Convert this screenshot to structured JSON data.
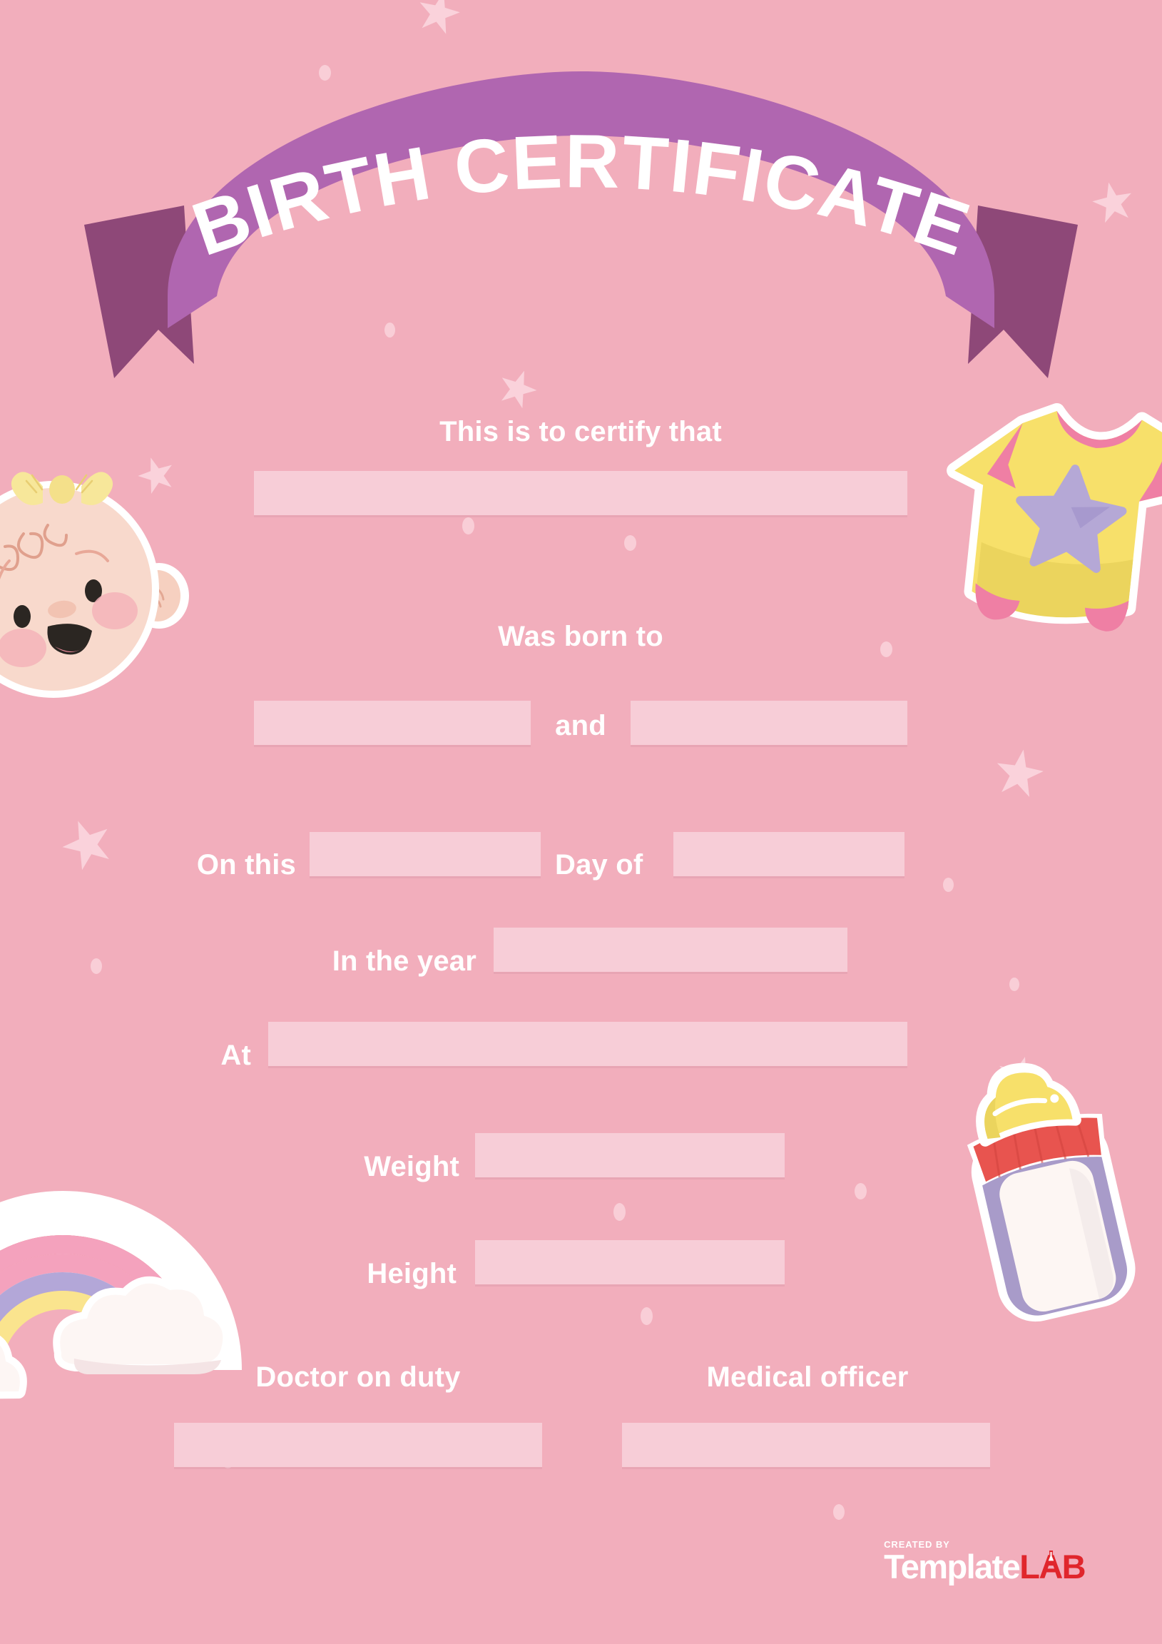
{
  "document": {
    "type": "birth-certificate-template",
    "title": "BIRTH CERTIFICATE"
  },
  "colors": {
    "background": "#F2AEBC",
    "field_fill": "#F7CDD7",
    "banner_front": "#B066B0",
    "banner_fold": "#8E4878",
    "text": "#FFFFFF",
    "star_decor": "#FAD4DC",
    "logo_red": "#E0262C",
    "onesie_yellow": "#F7E06A",
    "onesie_trim": "#EF7FA4",
    "onesie_star": "#B5A8D6",
    "bottle_cap": "#F7E06A",
    "bottle_ring": "#E8544F",
    "bottle_body": "#A89BC9",
    "bottle_milk": "#FDF6F3",
    "baby_skin": "#F8D9CC",
    "baby_bow": "#F7E79A",
    "baby_cheek": "#F4B3B9",
    "rainbow_band_1": "#E35F5A",
    "rainbow_band_2": "#F4A2BD",
    "rainbow_band_3": "#B3A7D8",
    "rainbow_band_4": "#FAE48E",
    "cloud": "#FDF6F4"
  },
  "banner": {
    "title": "BIRTH CERTIFICATE"
  },
  "form": {
    "certify_line": {
      "label": "This is to certify that",
      "field_value": "",
      "field_placeholder": ""
    },
    "born_to_line": {
      "label": "Was born to",
      "parent_one_value": "",
      "conjunction": "and",
      "parent_two_value": ""
    },
    "date_line": {
      "on_this_label": "On this",
      "day_value": "",
      "day_of_label": "Day of",
      "month_value": ""
    },
    "year_line": {
      "label": "In the year",
      "value": ""
    },
    "place_line": {
      "label": "At",
      "value": ""
    },
    "weight_line": {
      "label": "Weight",
      "value": ""
    },
    "height_line": {
      "label": "Height",
      "value": ""
    },
    "signatures": [
      {
        "label": "Doctor on duty",
        "value": ""
      },
      {
        "label": "Medical officer",
        "value": ""
      }
    ]
  },
  "stickers": [
    {
      "name": "baby-face-sticker",
      "position": "left-upper"
    },
    {
      "name": "onesie-sticker",
      "position": "right-upper"
    },
    {
      "name": "baby-bottle-sticker",
      "position": "right-lower"
    },
    {
      "name": "rainbow-cloud-sticker",
      "position": "left-lower"
    }
  ],
  "footer": {
    "created_by": "CREATED BY",
    "brand_first": "Template",
    "brand_second": "LAB"
  }
}
